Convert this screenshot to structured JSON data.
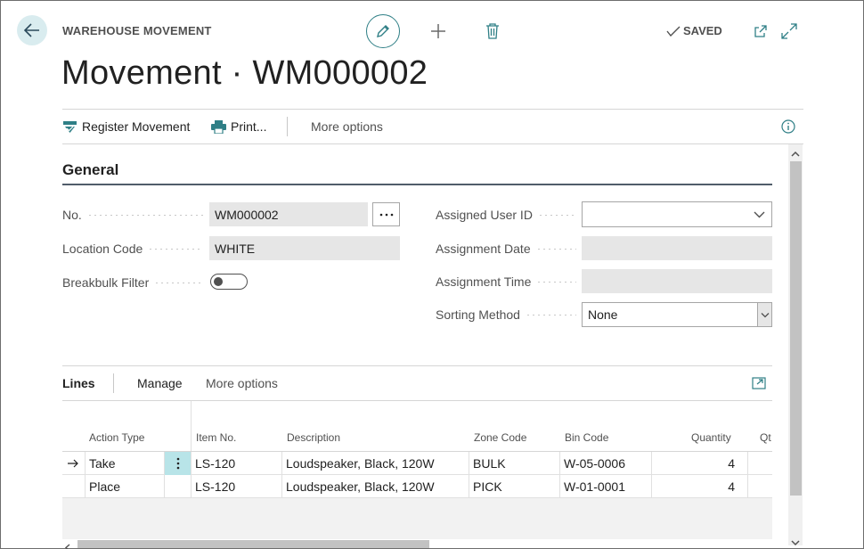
{
  "header": {
    "caption": "WAREHOUSE MOVEMENT",
    "title": "Movement · WM000002",
    "status": "SAVED"
  },
  "actions": {
    "register": "Register Movement",
    "print": "Print...",
    "more": "More options"
  },
  "general": {
    "title": "General",
    "no_label": "No.",
    "no_value": "WM000002",
    "location_label": "Location Code",
    "location_value": "WHITE",
    "breakbulk_label": "Breakbulk Filter",
    "assigned_user_label": "Assigned User ID",
    "assigned_user_value": "",
    "assignment_date_label": "Assignment Date",
    "assignment_date_value": "",
    "assignment_time_label": "Assignment Time",
    "assignment_time_value": "",
    "sorting_label": "Sorting Method",
    "sorting_value": "None"
  },
  "lines": {
    "title": "Lines",
    "manage": "Manage",
    "more": "More options",
    "columns": [
      "Action Type",
      "Item No.",
      "Description",
      "Zone Code",
      "Bin Code",
      "Quantity",
      "Qt"
    ],
    "rows": [
      {
        "action_type": "Take",
        "item_no": "LS-120",
        "description": "Loudspeaker, Black, 120W",
        "zone_code": "BULK",
        "bin_code": "W-05-0006",
        "quantity": "4"
      },
      {
        "action_type": "Place",
        "item_no": "LS-120",
        "description": "Loudspeaker, Black, 120W",
        "zone_code": "PICK",
        "bin_code": "W-01-0001",
        "quantity": "4"
      }
    ]
  }
}
